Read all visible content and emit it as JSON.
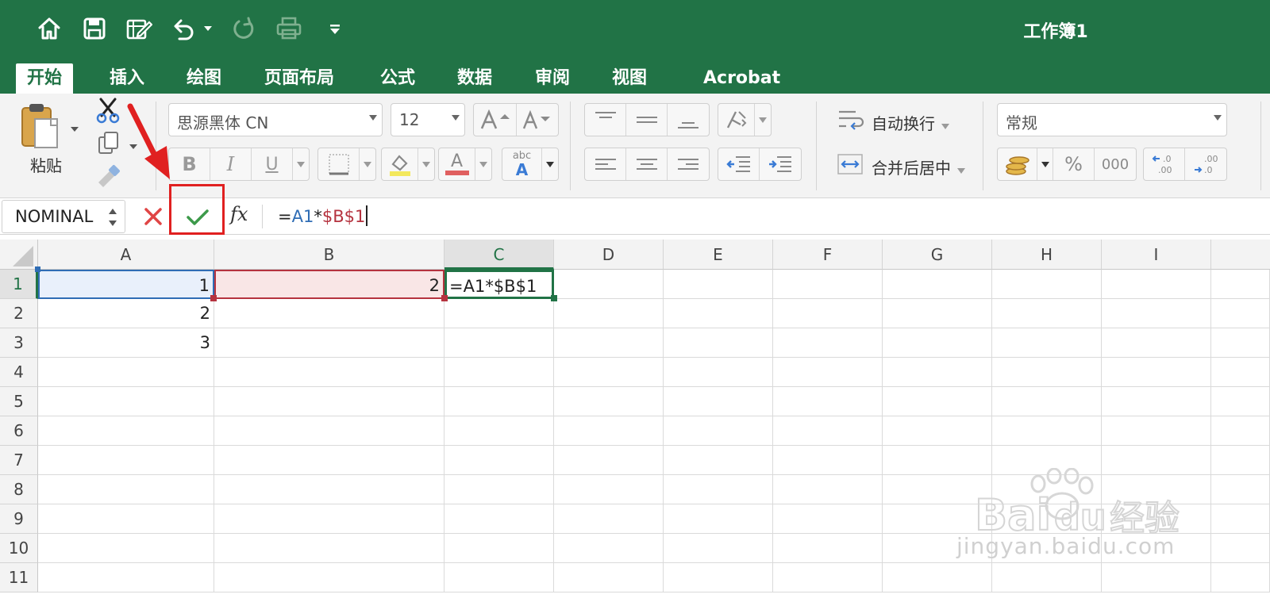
{
  "window": {
    "title": "工作簿1"
  },
  "quick_access": {
    "icons": [
      "home-icon",
      "save-icon",
      "edit-icon",
      "undo-icon",
      "redo-icon",
      "print-icon",
      "customize-icon"
    ]
  },
  "ribbon_tabs": [
    {
      "label": "开始",
      "active": true
    },
    {
      "label": "插入"
    },
    {
      "label": "绘图"
    },
    {
      "label": "页面布局"
    },
    {
      "label": "公式"
    },
    {
      "label": "数据"
    },
    {
      "label": "审阅"
    },
    {
      "label": "视图"
    },
    {
      "label": "Acrobat"
    }
  ],
  "clipboard": {
    "paste_label": "粘贴"
  },
  "font": {
    "family": "思源黑体 CN",
    "size": "12",
    "bold": "B",
    "italic": "I",
    "underline": "U",
    "font_color_letter": "A",
    "abc_label": "abc"
  },
  "alignment": {
    "wrap_text": "自动换行",
    "merge_center": "合并后居中"
  },
  "number": {
    "format": "常规",
    "percent": "%",
    "thousands": "000"
  },
  "formula_bar": {
    "name_box": "NOMINAL",
    "fx_label": "fx",
    "formula_parts": [
      {
        "text": "=",
        "color": "#222222"
      },
      {
        "text": "A1",
        "color": "#2f6db5"
      },
      {
        "text": "*",
        "color": "#222222"
      },
      {
        "text": "$B$1",
        "color": "#b5333f"
      }
    ]
  },
  "sheet": {
    "columns": [
      "A",
      "B",
      "C",
      "D",
      "E",
      "F",
      "G",
      "H",
      "I"
    ],
    "rows": [
      "1",
      "2",
      "3",
      "4",
      "5",
      "6",
      "7",
      "8",
      "9",
      "10",
      "11"
    ],
    "selected_column": "C",
    "selected_row": "1",
    "cells": {
      "A1": "1",
      "B1": "2",
      "C1": "=A1*$B$1",
      "A2": "2",
      "A3": "3"
    }
  },
  "colors": {
    "brand": "#217346",
    "ref_blue": "#2f6db5",
    "ref_red": "#b5333f",
    "annotation": "#e02020"
  },
  "watermark": {
    "brand": "Baidu经验",
    "url": "jingyan.baidu.com"
  }
}
